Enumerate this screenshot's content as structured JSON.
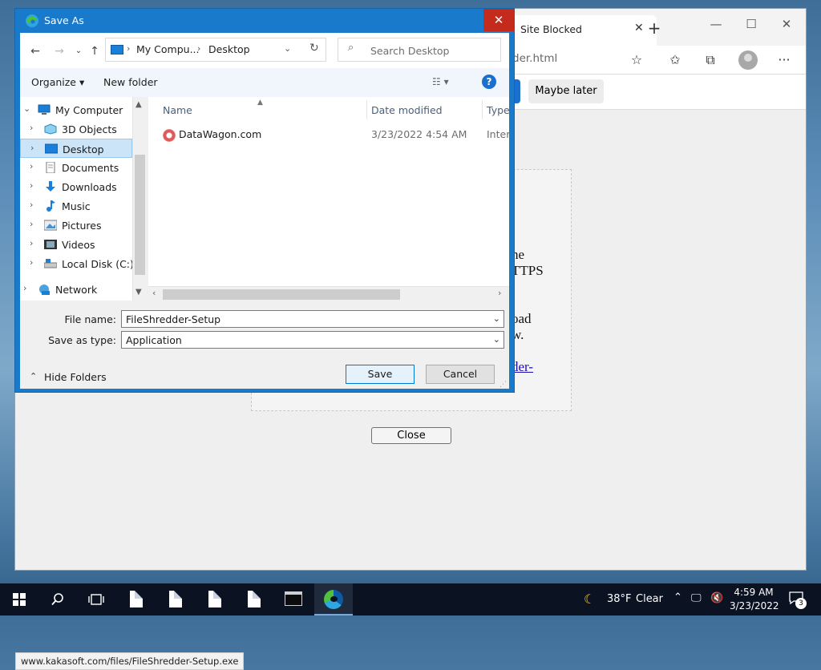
{
  "browser": {
    "tab_title": "Site Blocked",
    "url_partial": "der.html",
    "infobar": {
      "maybe_later": "Maybe later"
    },
    "notice_lines": [
      "he",
      "TTPS",
      "oad",
      "w.",
      "der-"
    ],
    "close_label": "Close",
    "status_url": "www.kakasoft.com/files/FileShredder-Setup.exe"
  },
  "dialog": {
    "title": "Save As",
    "close_glyph": "✕",
    "path": {
      "segments": [
        "My Compu...",
        "Desktop"
      ]
    },
    "search_placeholder": "Search Desktop",
    "commands": {
      "organize": "Organize ▾",
      "new_folder": "New folder"
    },
    "tree": [
      {
        "label": "My Computer",
        "level": 0,
        "icon": "computer-icon"
      },
      {
        "label": "3D Objects",
        "level": 1,
        "icon": "3d-objects-icon"
      },
      {
        "label": "Desktop",
        "level": 1,
        "icon": "desktop-icon",
        "selected": true
      },
      {
        "label": "Documents",
        "level": 1,
        "icon": "documents-icon"
      },
      {
        "label": "Downloads",
        "level": 1,
        "icon": "downloads-icon"
      },
      {
        "label": "Music",
        "level": 1,
        "icon": "music-icon"
      },
      {
        "label": "Pictures",
        "level": 1,
        "icon": "pictures-icon"
      },
      {
        "label": "Videos",
        "level": 1,
        "icon": "videos-icon"
      },
      {
        "label": "Local Disk (C:)",
        "level": 1,
        "icon": "local-disk-icon"
      },
      {
        "label": "Network",
        "level": 0,
        "icon": "network-icon"
      }
    ],
    "columns": {
      "name": "Name",
      "date_modified": "Date modified",
      "type": "Type"
    },
    "files": [
      {
        "name": "DataWagon.com",
        "date_modified": "3/23/2022 4:54 AM",
        "type": "Intern"
      }
    ],
    "file_name_label": "File name:",
    "file_name_value": "FileShredder-Setup",
    "save_as_type_label": "Save as type:",
    "save_as_type_value": "Application",
    "hide_folders": "Hide Folders",
    "save_label": "Save",
    "cancel_label": "Cancel"
  },
  "taskbar": {
    "weather": {
      "temp": "38°F",
      "condition": "Clear"
    },
    "time": "4:59 AM",
    "date": "3/23/2022",
    "notifications": "3"
  },
  "colors": {
    "dialog_frame": "#1979ca",
    "close_red": "#c42b1c",
    "selection": "#cce4f7",
    "link": "#1a0dab",
    "taskbar": "#0b1222"
  }
}
